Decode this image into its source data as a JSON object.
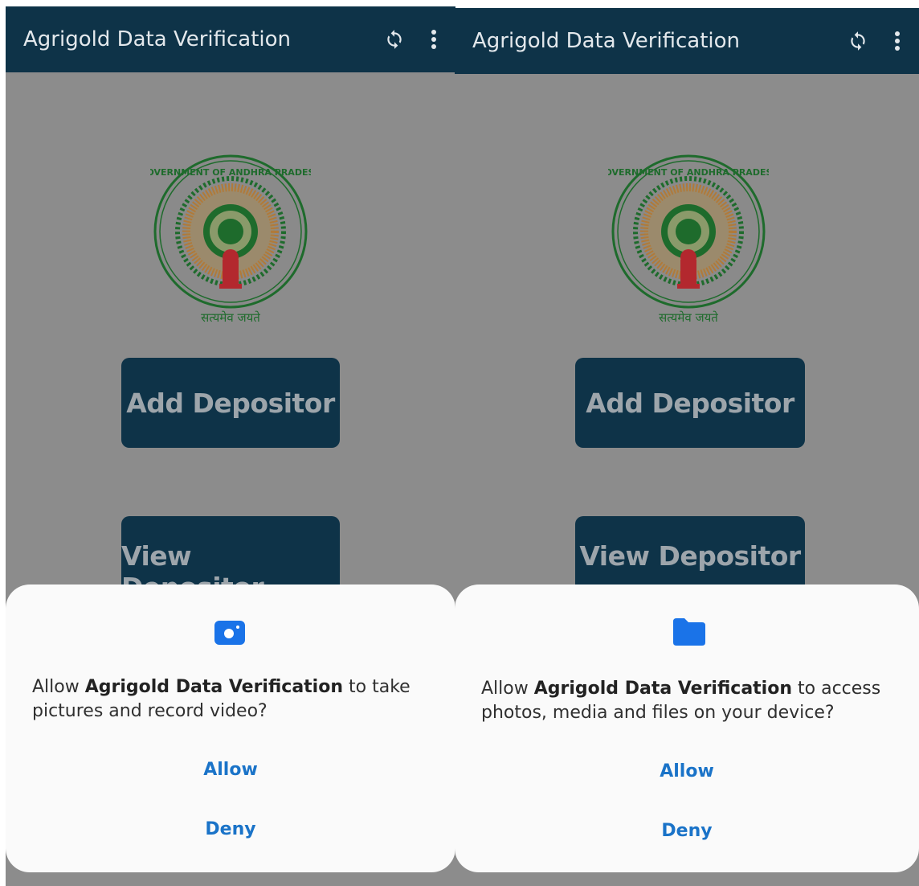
{
  "screens": [
    {
      "appbar": {
        "title": "Agrigold Data Verification",
        "sync_icon": "sync-icon",
        "more_icon": "more-vert-icon"
      },
      "emblem": {
        "top_text": "GOVERNMENT OF ANDHRA PRADESH",
        "motto": "सत्यमेव जयते"
      },
      "buttons": {
        "add": "Add Depositor",
        "view": "View Depositor"
      },
      "dialog": {
        "icon": "camera-icon",
        "prefix": "Allow ",
        "app_name": "Agrigold Data Verification",
        "suffix_line1": " to take",
        "line2": "pictures and record video?",
        "allow": "Allow",
        "deny": "Deny"
      }
    },
    {
      "appbar": {
        "title": "Agrigold Data Verification",
        "sync_icon": "sync-icon",
        "more_icon": "more-vert-icon"
      },
      "emblem": {
        "top_text": "GOVERNMENT OF ANDHRA PRADESH",
        "motto": "सत्यमेव जयते"
      },
      "buttons": {
        "add": "Add Depositor",
        "view": "View Depositor"
      },
      "dialog": {
        "icon": "folder-icon",
        "prefix": "Allow ",
        "app_name": "Agrigold Data Verification",
        "suffix_line1": " to access",
        "line2": "photos, media and files on your device?",
        "allow": "Allow",
        "deny": "Deny"
      }
    }
  ],
  "colors": {
    "appbar": "#0e3348",
    "scrim": "#8c8c8c",
    "accent": "#1a73c8",
    "sheet": "#fafafa",
    "icon_blue": "#1a73e8"
  }
}
